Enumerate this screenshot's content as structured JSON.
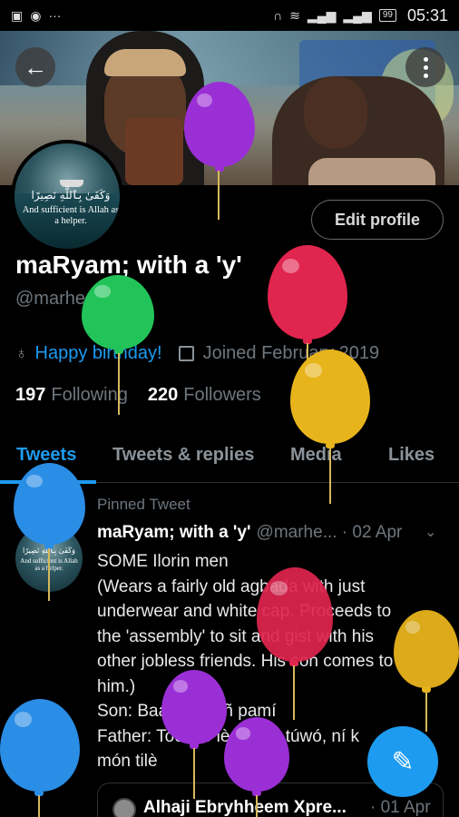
{
  "status_bar": {
    "time": "05:31",
    "battery": "99"
  },
  "profile": {
    "display_name": "maRyam; with a 'y'",
    "handle": "@marheeyherm",
    "edit_profile_label": "Edit profile",
    "birthday_text": "Happy birthday!",
    "joined_text": "Joined February 2019",
    "following_count": "197",
    "following_label": "Following",
    "followers_count": "220",
    "followers_label": "Followers",
    "avatar_arabic": "وَكَفَىٰ بِٱللَّهِ نَصِيرًا",
    "avatar_text": "And sufficient is Allah as a helper."
  },
  "tabs": [
    {
      "label": "Tweets",
      "active": true
    },
    {
      "label": "Tweets & replies",
      "active": false
    },
    {
      "label": "Media",
      "active": false
    },
    {
      "label": "Likes",
      "active": false
    }
  ],
  "pinned_tweet": {
    "pinned_label": "Pinned Tweet",
    "author_name": "maRyam; with a 'y'",
    "author_meta": "@marhe... · 02 Apr",
    "lines": [
      "SOME Ilorin men",
      "(Wears a fairly old agbada with just",
      "underwear and white cap. Proceeds to",
      "the 'assembly' to sit and gist with his",
      "other jobless friends. His son comes to",
      "him.)",
      "Son: Baami, ebi ñ pamí",
      "Father: Toor, lo lè bá iyá túwó, ní k",
      "món tilè"
    ],
    "quoted": {
      "name": "Alhaji Ebryhheem Xpre...",
      "date": "01 Apr"
    }
  },
  "colors": {
    "accent": "#1d9bf0",
    "balloon_purple": "#9b2fd6",
    "balloon_red": "#e0254f",
    "balloon_green": "#22c45a",
    "balloon_yellow": "#e8b41c",
    "balloon_blue": "#2a8de6"
  },
  "icons": {
    "back": "arrow-left-icon",
    "more": "vertical-dots-icon",
    "birthday": "balloon-icon",
    "calendar": "calendar-icon",
    "pin": "pin-icon",
    "compose": "feather-plus-icon"
  }
}
